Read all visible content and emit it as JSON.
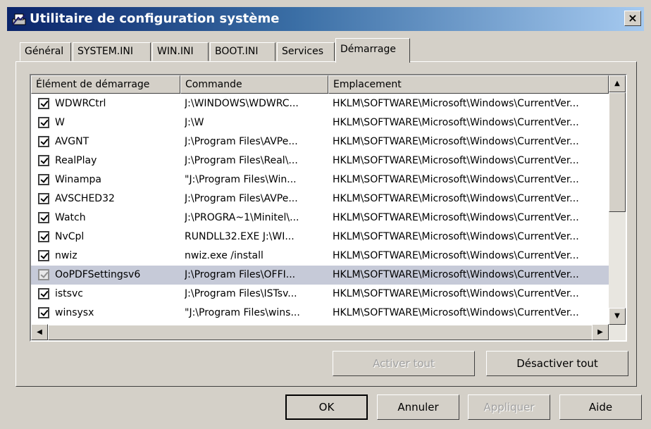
{
  "window": {
    "title": "Utilitaire de configuration système",
    "close_label": "×"
  },
  "tabs": [
    {
      "label": "Général"
    },
    {
      "label": "SYSTEM.INI"
    },
    {
      "label": "WIN.INI"
    },
    {
      "label": "BOOT.INI"
    },
    {
      "label": "Services"
    },
    {
      "label": "Démarrage"
    }
  ],
  "active_tab": "Démarrage",
  "list": {
    "columns": [
      "Élément de démarrage",
      "Commande",
      "Emplacement"
    ],
    "rows": [
      {
        "name": "WDWRCtrl",
        "command": "J:\\WINDOWS\\WDWRC...",
        "location": "HKLM\\SOFTWARE\\Microsoft\\Windows\\CurrentVer...",
        "checked": true
      },
      {
        "name": "W",
        "command": "J:\\W",
        "location": "HKLM\\SOFTWARE\\Microsoft\\Windows\\CurrentVer...",
        "checked": true
      },
      {
        "name": "AVGNT",
        "command": "J:\\Program Files\\AVPe...",
        "location": "HKLM\\SOFTWARE\\Microsoft\\Windows\\CurrentVer...",
        "checked": true
      },
      {
        "name": "RealPlay",
        "command": "J:\\Program Files\\Real\\...",
        "location": "HKLM\\SOFTWARE\\Microsoft\\Windows\\CurrentVer...",
        "checked": true
      },
      {
        "name": "Winampa",
        "command": "\"J:\\Program Files\\Win...",
        "location": "HKLM\\SOFTWARE\\Microsoft\\Windows\\CurrentVer...",
        "checked": true
      },
      {
        "name": "AVSCHED32",
        "command": "J:\\Program Files\\AVPe...",
        "location": "HKLM\\SOFTWARE\\Microsoft\\Windows\\CurrentVer...",
        "checked": true
      },
      {
        "name": "Watch",
        "command": "J:\\PROGRA~1\\Minitel\\...",
        "location": "HKLM\\SOFTWARE\\Microsoft\\Windows\\CurrentVer...",
        "checked": true
      },
      {
        "name": "NvCpl",
        "command": "RUNDLL32.EXE J:\\WI...",
        "location": "HKLM\\SOFTWARE\\Microsoft\\Windows\\CurrentVer...",
        "checked": true
      },
      {
        "name": "nwiz",
        "command": "nwiz.exe /install",
        "location": "HKLM\\SOFTWARE\\Microsoft\\Windows\\CurrentVer...",
        "checked": true
      },
      {
        "name": "OoPDFSettingsv6",
        "command": "J:\\Program Files\\OFFI...",
        "location": "HKLM\\SOFTWARE\\Microsoft\\Windows\\CurrentVer...",
        "checked": true
      },
      {
        "name": "istsvc",
        "command": "J:\\Program Files\\ISTsv...",
        "location": "HKLM\\SOFTWARE\\Microsoft\\Windows\\CurrentVer...",
        "checked": true
      },
      {
        "name": "winsysx",
        "command": "\"J:\\Program Files\\wins...",
        "location": "HKLM\\SOFTWARE\\Microsoft\\Windows\\CurrentVer...",
        "checked": true
      }
    ],
    "selected_row": 9
  },
  "panel_buttons": {
    "enable_all": "Activer tout",
    "disable_all": "Désactiver tout"
  },
  "dialog_buttons": {
    "ok": "OK",
    "cancel": "Annuler",
    "apply": "Appliquer",
    "help": "Aide"
  },
  "icons": {
    "title": "system-config-icon",
    "scroll_up": "arrow-up-icon",
    "scroll_down": "arrow-down-icon",
    "scroll_left": "arrow-left-icon",
    "scroll_right": "arrow-right-icon"
  },
  "colors": {
    "titlebar_start": "#0a246a",
    "titlebar_end": "#a6caf0",
    "face": "#d4d0c8",
    "selected_row": "#c6cad8"
  }
}
